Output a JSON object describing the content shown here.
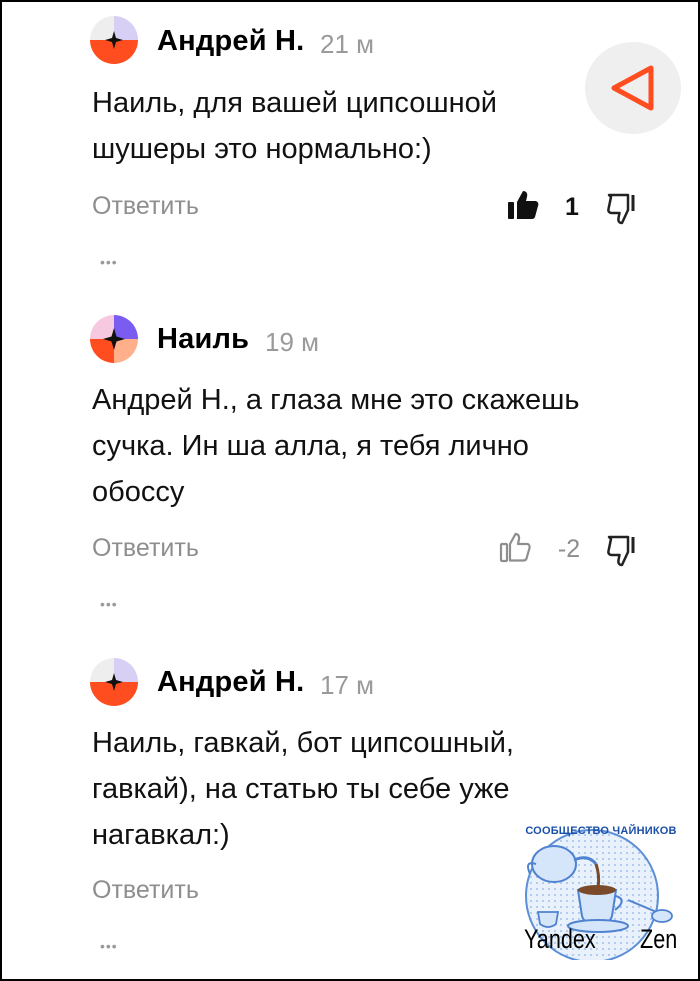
{
  "comments": [
    {
      "author": "Андрей Н.",
      "time": "21 м",
      "lines": [
        "Наиль, для вашей ципсошной",
        "шушеры это нормально:)"
      ],
      "reply_label": "Ответить",
      "rating": "1",
      "liked": true,
      "more": "•••"
    },
    {
      "author": "Наиль",
      "time": "19 м",
      "lines": [
        "Андрей Н., а глаза мне это скажешь",
        "сучка. Ин ша алла, я тебя лично",
        "обоссу"
      ],
      "reply_label": "Ответить",
      "rating": "-2",
      "liked": false,
      "more": "•••"
    },
    {
      "author": "Андрей Н.",
      "time": "17 м",
      "lines": [
        "Наиль, гавкай, бот ципсошный,",
        "гавкай), на статью ты себе уже",
        "нагавкал:)"
      ],
      "reply_label": "Ответить",
      "more": "•••"
    }
  ],
  "watermark": {
    "title": "СООБЩЕСТВО ЧАЙНИКОВ",
    "yandex": "Yandex",
    "zen": "Zen"
  },
  "colors": {
    "accent": "#ff4d1f",
    "avatar_purple": "#7a5cf0",
    "avatar_lavender": "#d8cff5",
    "avatar_pink": "#f7c9e0",
    "avatar_peach": "#ffb08a",
    "muted_text": "#8e8e8e"
  }
}
